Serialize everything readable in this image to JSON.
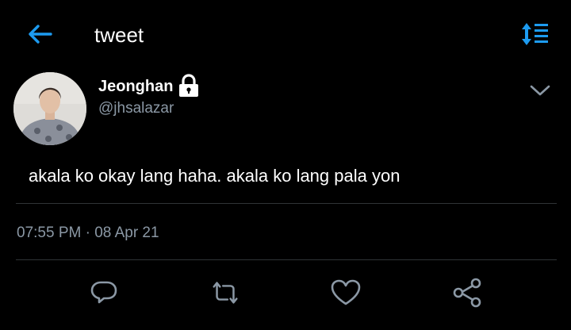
{
  "header": {
    "title": "tweet",
    "back_icon": "arrow-left-icon",
    "sort_icon": "sort-list-icon",
    "accent_color": "#1d9bf0"
  },
  "tweet": {
    "display_name": "Jeonghan",
    "handle": "@jhsalazar",
    "protected_icon": "lock-icon",
    "text": "akala ko okay lang haha. akala ko lang pala yon",
    "time": "07:55 PM",
    "separator": "·",
    "date": "08 Apr 21"
  },
  "actions": [
    {
      "name": "reply",
      "icon": "reply-icon"
    },
    {
      "name": "retweet",
      "icon": "retweet-icon"
    },
    {
      "name": "like",
      "icon": "heart-icon"
    },
    {
      "name": "share",
      "icon": "share-icon"
    }
  ],
  "colors": {
    "background": "#000000",
    "text_primary": "#ffffff",
    "text_secondary": "#8b98a5",
    "icon_gray": "#8b98a5",
    "divider": "#2f3336"
  }
}
